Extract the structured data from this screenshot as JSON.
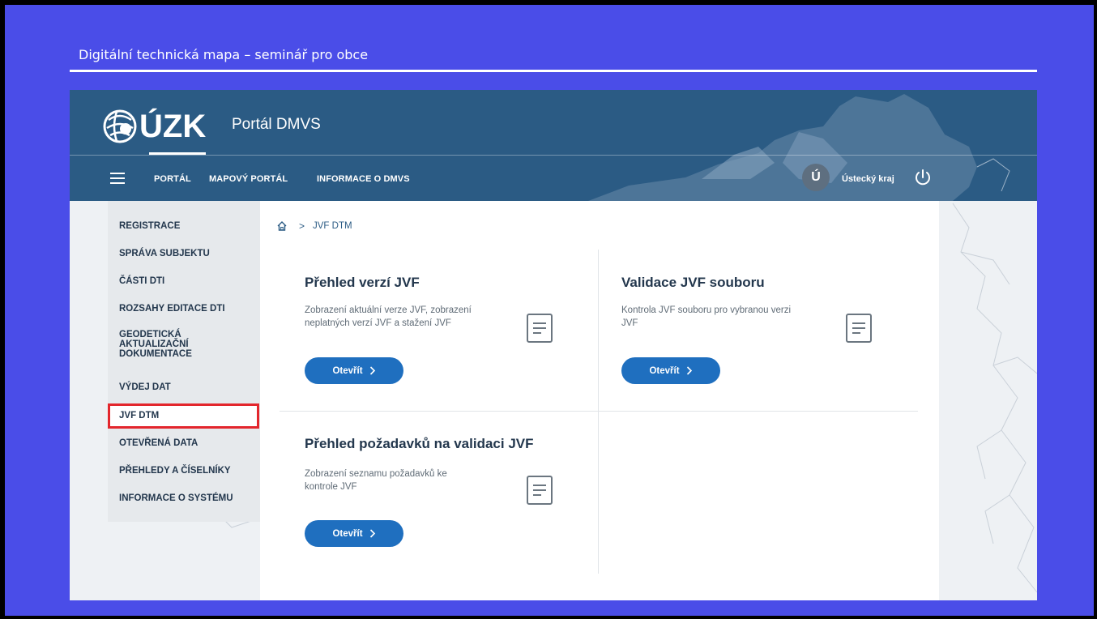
{
  "slide": {
    "title": "Digitální technická mapa – seminář pro obce"
  },
  "header": {
    "logo_text": "ÚZK",
    "portal_name": "Portál DMVS",
    "nav": [
      {
        "label": "PORTÁL",
        "active": true
      },
      {
        "label": "MAPOVÝ PORTÁL",
        "active": false
      },
      {
        "label": "INFORMACE O DMVS",
        "active": false
      }
    ],
    "user_initial": "Ú",
    "user_region": "Ústecký kraj"
  },
  "sidebar": {
    "items": [
      {
        "label": "REGISTRACE"
      },
      {
        "label": "SPRÁVA SUBJEKTU"
      },
      {
        "label": "ČÁSTI DTI"
      },
      {
        "label": "ROZSAHY EDITACE DTI"
      },
      {
        "label": "GEODETICKÁ AKTUALIZAČNÍ DOKUMENTACE"
      },
      {
        "label": "VÝDEJ DAT"
      },
      {
        "label": "JVF DTM",
        "selected": true
      },
      {
        "label": "OTEVŘENÁ DATA"
      },
      {
        "label": "PŘEHLEDY A ČÍSELNÍKY"
      },
      {
        "label": "INFORMACE O SYSTÉMU"
      }
    ]
  },
  "breadcrumb": {
    "current": "JVF DTM"
  },
  "cards": [
    {
      "title": "Přehled verzí JVF",
      "description": "Zobrazení aktuální verze JVF, zobrazení neplatných verzí JVF a stažení JVF",
      "button": "Otevřít"
    },
    {
      "title": "Validace JVF souboru",
      "description": "Kontrola JVF souboru pro vybranou verzi JVF",
      "button": "Otevřít"
    },
    {
      "title": "Přehled požadavků na validaci JVF",
      "description": "Zobrazení seznamu požadavků ke kontrole JVF",
      "button": "Otevřít"
    }
  ],
  "colors": {
    "slide_background": "#4a4de8",
    "header": "#2b5b84",
    "button": "#1f6fbf",
    "highlight": "#e3262c"
  }
}
